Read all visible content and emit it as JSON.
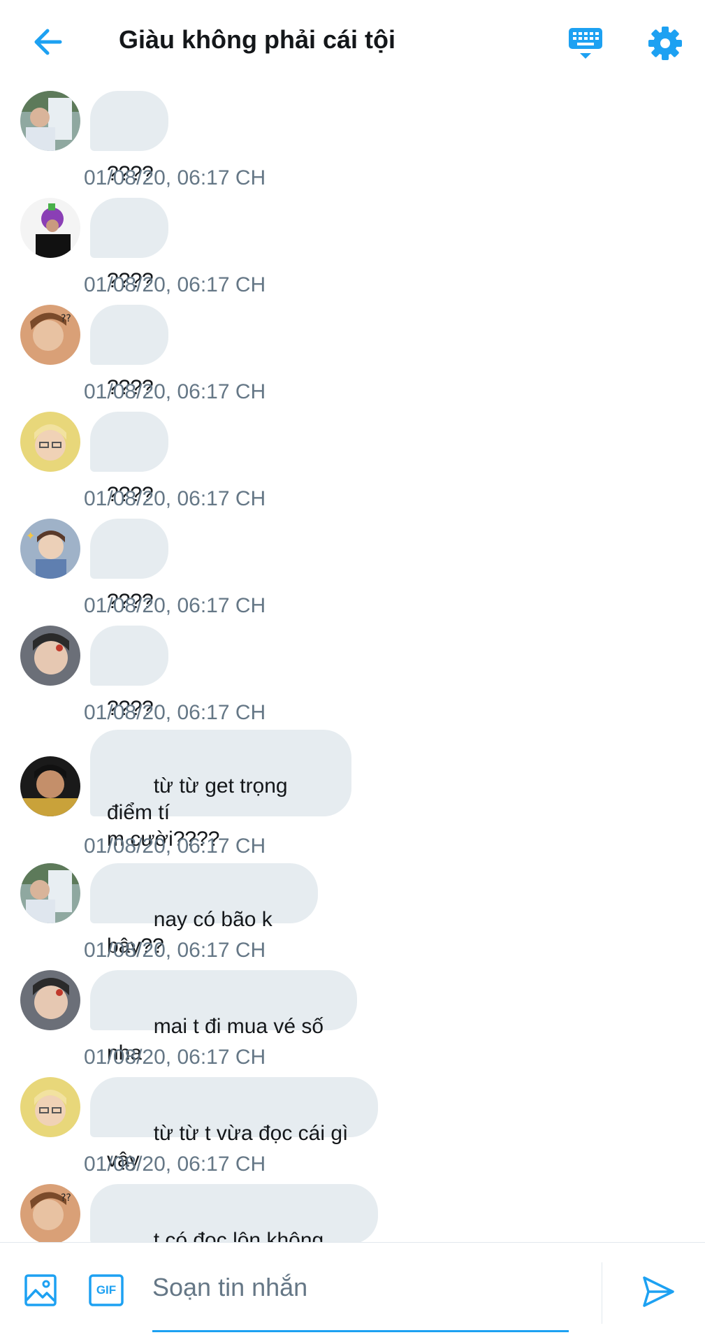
{
  "header": {
    "title": "Giàu không phải cái tội"
  },
  "messages": [
    {
      "text": "????",
      "time": "01/08/20, 06:17 CH",
      "avatar": "avatar-1"
    },
    {
      "text": "????",
      "time": "01/08/20, 06:17 CH",
      "avatar": "avatar-2"
    },
    {
      "text": "????",
      "time": "01/08/20, 06:17 CH",
      "avatar": "avatar-3"
    },
    {
      "text": "????",
      "time": "01/08/20, 06:17 CH",
      "avatar": "avatar-4"
    },
    {
      "text": "????",
      "time": "01/08/20, 06:17 CH",
      "avatar": "avatar-5"
    },
    {
      "text": "????",
      "time": "01/08/20, 06:17 CH",
      "avatar": "avatar-6"
    },
    {
      "text": "từ từ get trọng điểm tí\nm cười????",
      "time": "01/08/20, 06:17 CH",
      "avatar": "avatar-7"
    },
    {
      "text": "nay có bão k bây??",
      "time": "01/08/20, 06:17 CH",
      "avatar": "avatar-1"
    },
    {
      "text": "mai t đi mua vé số nha",
      "time": "01/08/20, 06:17 CH",
      "avatar": "avatar-6"
    },
    {
      "text": "từ từ t vừa đọc cái gì vậy",
      "time": "01/08/20, 06:17 CH",
      "avatar": "avatar-4"
    },
    {
      "text": "t có đọc lộn không vậy??",
      "time": "",
      "avatar": "avatar-3"
    }
  ],
  "composer": {
    "placeholder": "Soạn tin nhắn",
    "gif_label": "GIF"
  },
  "icons": {
    "back": "arrow-left-icon",
    "keyboard": "keyboard-icon",
    "settings": "gear-icon",
    "image": "image-icon",
    "gif": "gif-icon",
    "send": "send-icon"
  },
  "colors": {
    "accent": "#1da1f2",
    "bubble": "#e6ecf0",
    "timestamp": "#657786",
    "text": "#14171a"
  }
}
